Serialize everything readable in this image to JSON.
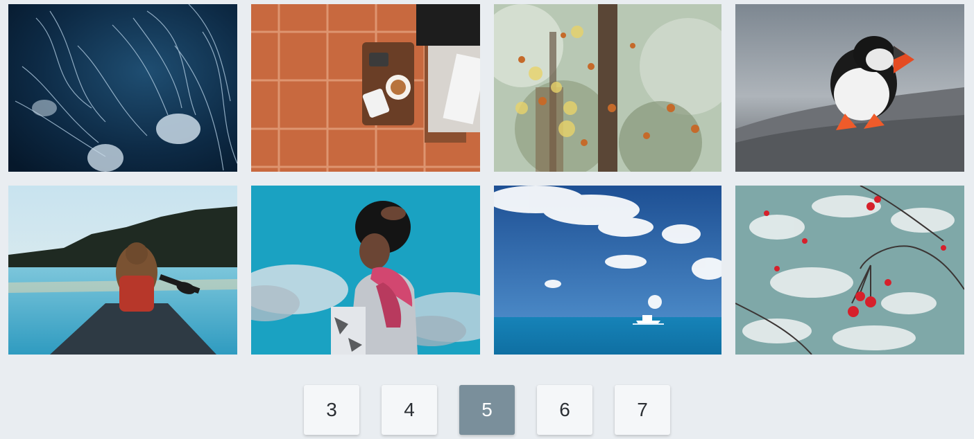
{
  "gallery": {
    "photos": [
      {
        "subject": "jellyfish"
      },
      {
        "subject": "coffee-table-tiles"
      },
      {
        "subject": "autumn-forest"
      },
      {
        "subject": "puffin"
      },
      {
        "subject": "woman-in-canoe"
      },
      {
        "subject": "man-with-pink-scarf"
      },
      {
        "subject": "boat-on-ocean"
      },
      {
        "subject": "red-berries-snow"
      }
    ]
  },
  "pagination": {
    "pages": [
      "3",
      "4",
      "5",
      "6",
      "7"
    ],
    "current": "5",
    "active_color": "#7a8f9b",
    "button_color": "#f5f7f9"
  },
  "colors": {
    "background": "#e9edf1"
  }
}
